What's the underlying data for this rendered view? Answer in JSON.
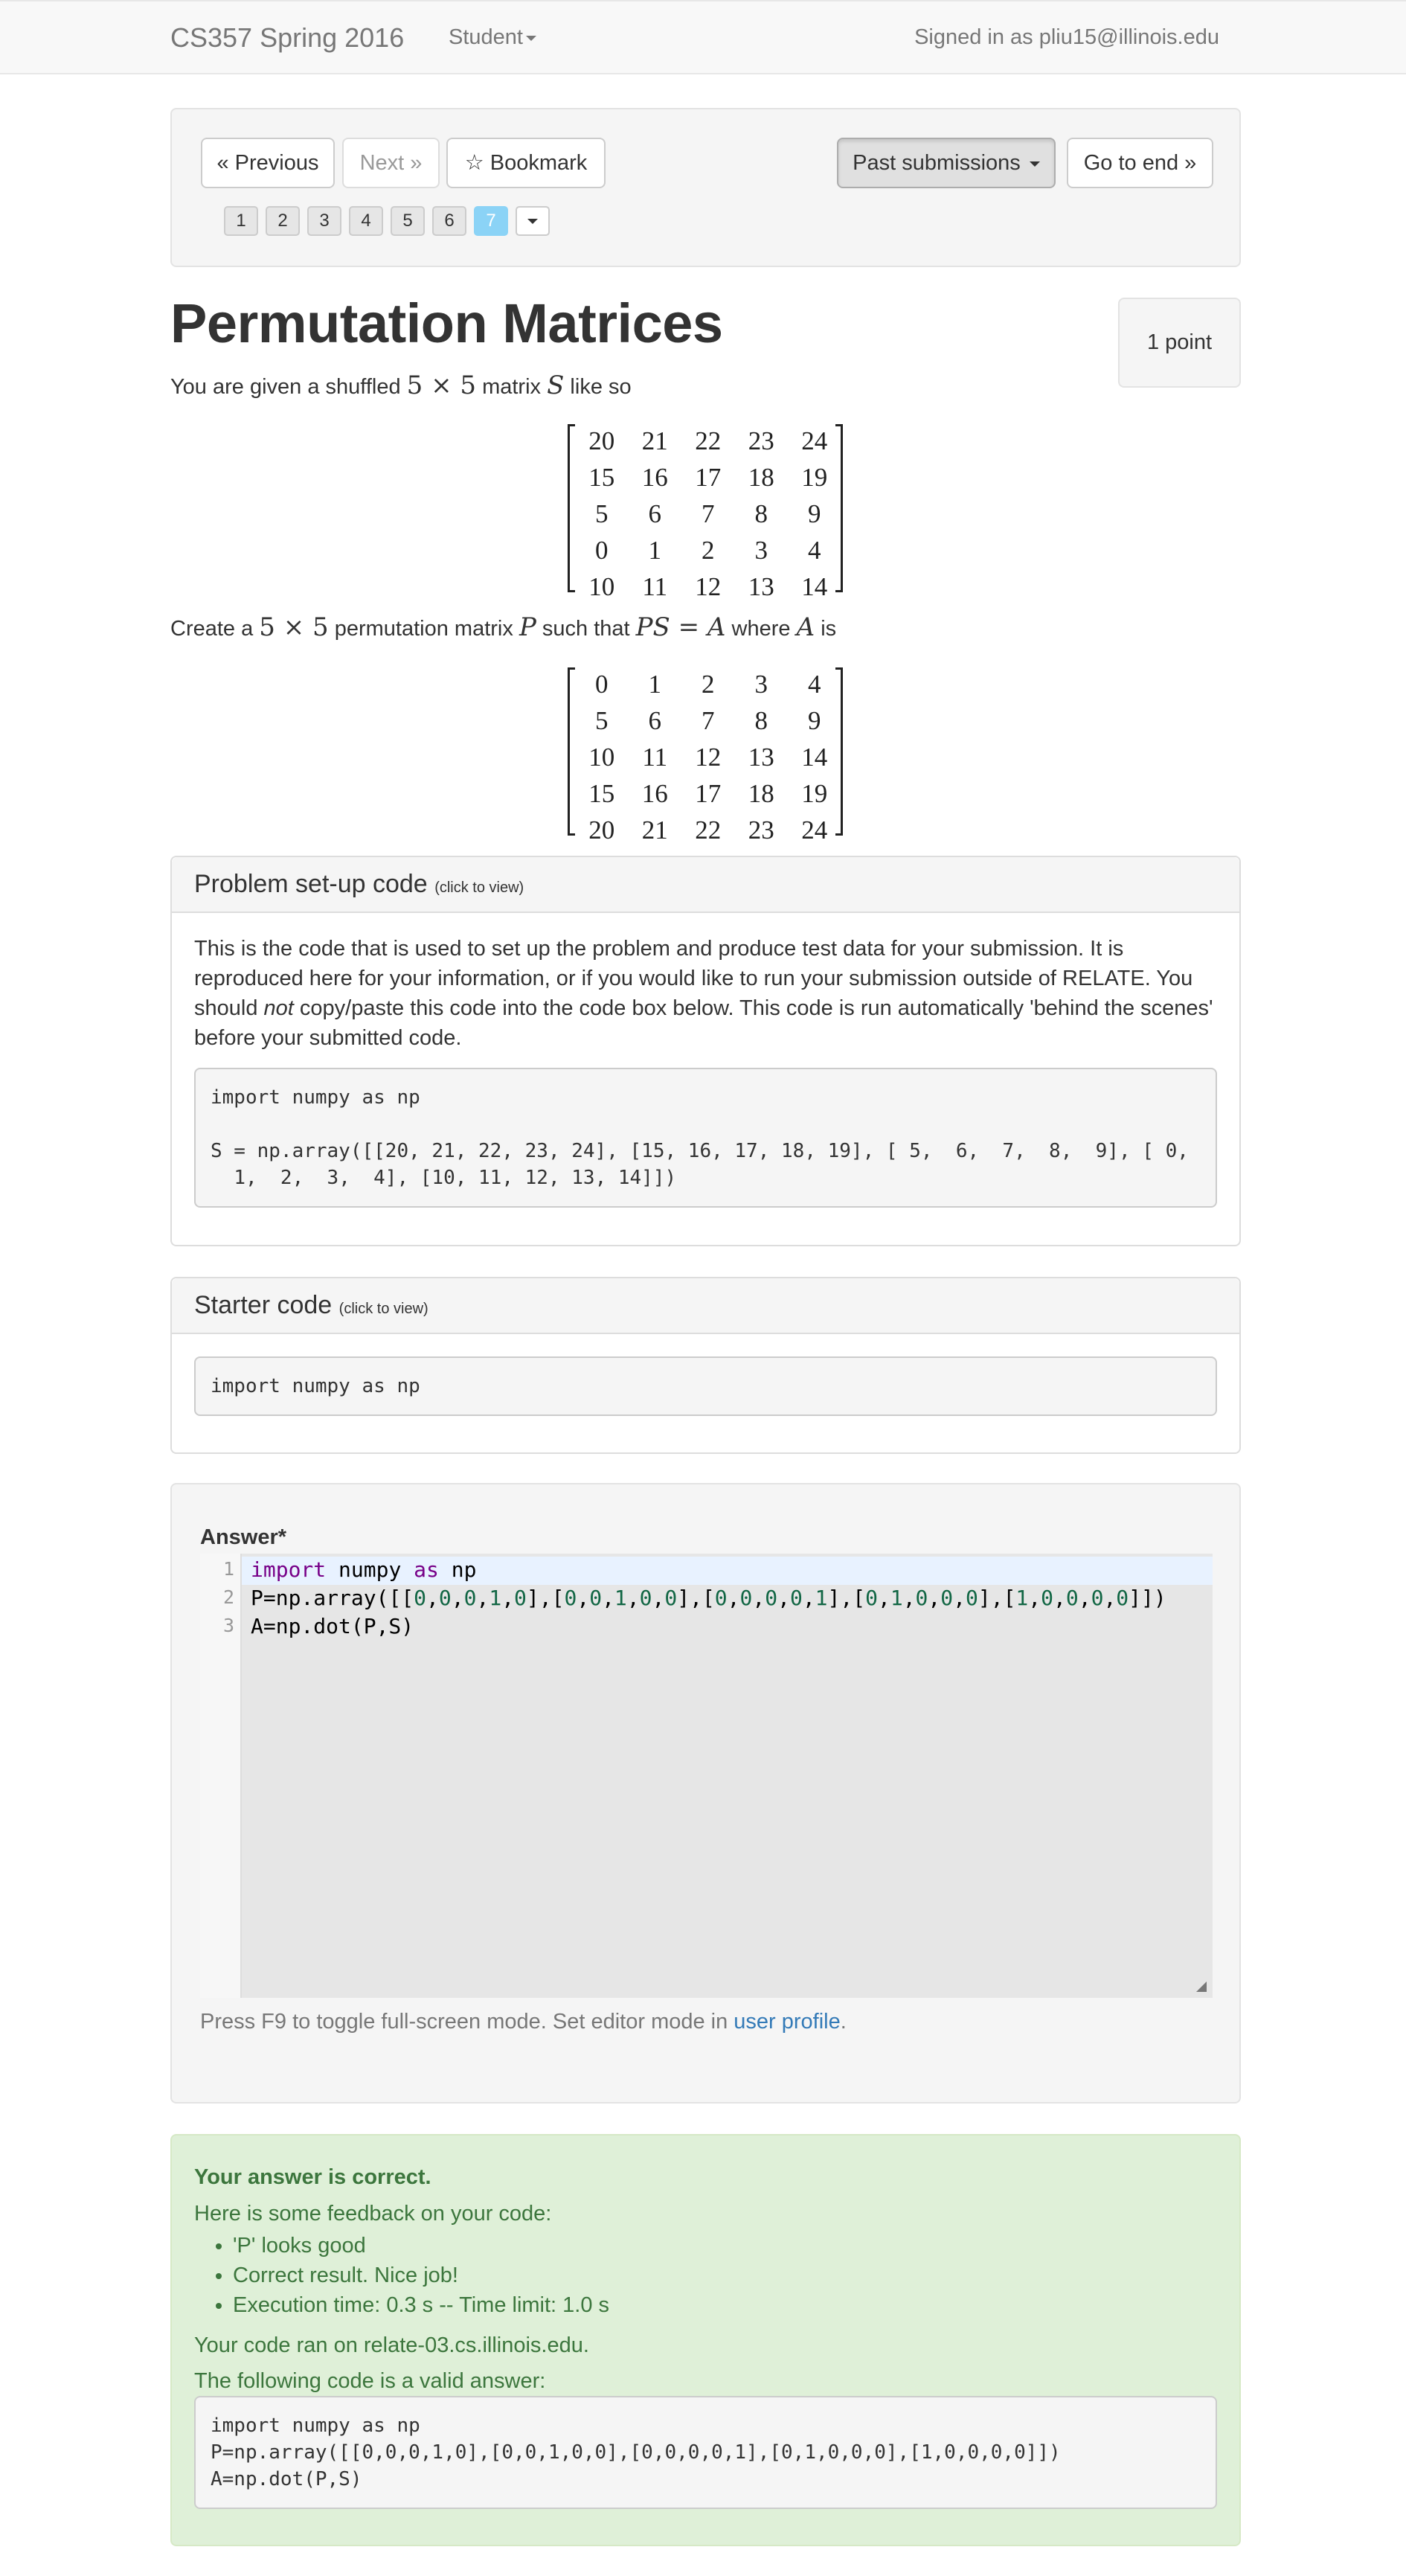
{
  "navbar": {
    "brand": "CS357 Spring 2016",
    "student_menu": "Student",
    "signed_in": "Signed in as pliu15@illinois.edu"
  },
  "nav": {
    "previous": "« Previous",
    "next": "Next »",
    "bookmark": "☆ Bookmark",
    "past_submissions": "Past submissions",
    "go_to_end": "Go to end »",
    "pages": [
      "1",
      "2",
      "3",
      "4",
      "5",
      "6",
      "7"
    ],
    "current_page": "7"
  },
  "problem": {
    "title": "Permutation Matrices",
    "points": "1 point",
    "intro_prefix": "You are given a shuffled ",
    "intro_dim": "5 × 5",
    "intro_mid": " matrix ",
    "intro_var": "S",
    "intro_suffix": " like so",
    "create_prefix": "Create a ",
    "create_dim": "5 × 5",
    "create_mid": " permutation matrix ",
    "create_var_p": "P",
    "create_mid2": " such that ",
    "create_eq": "PS = A",
    "create_mid3": " where ",
    "create_var_a": "A",
    "create_suffix": " is",
    "matrix_S": [
      [
        20,
        21,
        22,
        23,
        24
      ],
      [
        15,
        16,
        17,
        18,
        19
      ],
      [
        5,
        6,
        7,
        8,
        9
      ],
      [
        0,
        1,
        2,
        3,
        4
      ],
      [
        10,
        11,
        12,
        13,
        14
      ]
    ],
    "matrix_A": [
      [
        0,
        1,
        2,
        3,
        4
      ],
      [
        5,
        6,
        7,
        8,
        9
      ],
      [
        10,
        11,
        12,
        13,
        14
      ],
      [
        15,
        16,
        17,
        18,
        19
      ],
      [
        20,
        21,
        22,
        23,
        24
      ]
    ]
  },
  "setup_panel": {
    "heading": "Problem set-up code",
    "heading_small": "(click to view)",
    "desc_1": "This is the code that is used to set up the problem and produce test data for your submission. It is reproduced here for your information, or if you would like to run your submission outside of RELATE. You should ",
    "desc_em": "not",
    "desc_2": " copy/paste this code into the code box below. This code is run automatically 'behind the scenes' before your submitted code.",
    "code": "import numpy as np\n\nS = np.array([[20, 21, 22, 23, 24], [15, 16, 17, 18, 19], [ 5,  6,  7,  8,  9], [ 0,\n  1,  2,  3,  4], [10, 11, 12, 13, 14]])"
  },
  "starter_panel": {
    "heading": "Starter code",
    "heading_small": "(click to view)",
    "code": "import numpy as np"
  },
  "answer": {
    "label": "Answer*",
    "line_numbers": [
      "1",
      "2",
      "3"
    ],
    "line1_kw1": "import",
    "line1_mid": " numpy ",
    "line1_kw2": "as",
    "line1_end": " np",
    "line2": "P=np.array([[0,0,0,1,0],[0,0,1,0,0],[0,0,0,0,1],[0,1,0,0,0],[1,0,0,0,0]])",
    "line3": "A=np.dot(P,S)",
    "hint_prefix": "Press F9 to toggle full-screen mode. Set editor mode in ",
    "hint_link": "user profile",
    "hint_suffix": "."
  },
  "feedback": {
    "status": "Your answer is correct.",
    "intro": "Here is some feedback on your code:",
    "items": [
      "'P' looks good",
      "Correct result. Nice job!",
      "Execution time: 0.3 s -- Time limit: 1.0 s"
    ],
    "ran_on": "Your code ran on relate-03.cs.illinois.edu.",
    "valid_answer_label": "The following code is a valid answer:",
    "valid_code": "import numpy as np\nP=np.array([[0,0,0,1,0],[0,0,1,0,0],[0,0,0,0,1],[0,1,0,0,0],[1,0,0,0,0]])\nA=np.dot(P,S)"
  }
}
